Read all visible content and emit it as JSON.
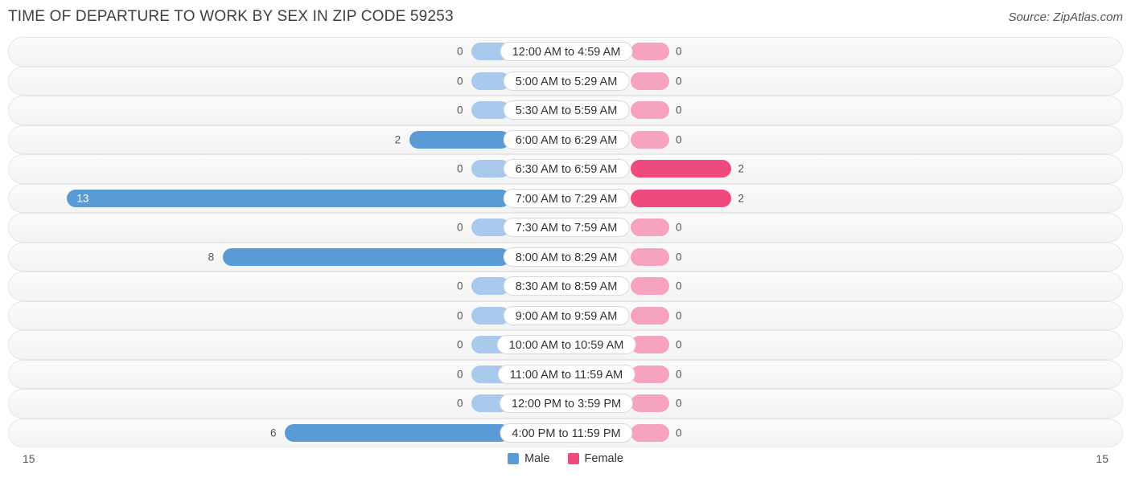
{
  "header": {
    "title": "TIME OF DEPARTURE TO WORK BY SEX IN ZIP CODE 59253",
    "source": "Source: ZipAtlas.com"
  },
  "legend": {
    "male_label": "Male",
    "female_label": "Female",
    "male_color": "#5b9bd5",
    "female_color": "#ef4a7e"
  },
  "axis": {
    "left_max": "15",
    "right_max": "15"
  },
  "chart_data": {
    "type": "bar",
    "orientation": "horizontal-diverging",
    "title": "TIME OF DEPARTURE TO WORK BY SEX IN ZIP CODE 59253",
    "xlabel": "",
    "ylabel": "",
    "xlim": [
      15,
      15
    ],
    "grid": false,
    "legend_position": "bottom-center",
    "categories": [
      "12:00 AM to 4:59 AM",
      "5:00 AM to 5:29 AM",
      "5:30 AM to 5:59 AM",
      "6:00 AM to 6:29 AM",
      "6:30 AM to 6:59 AM",
      "7:00 AM to 7:29 AM",
      "7:30 AM to 7:59 AM",
      "8:00 AM to 8:29 AM",
      "8:30 AM to 8:59 AM",
      "9:00 AM to 9:59 AM",
      "10:00 AM to 10:59 AM",
      "11:00 AM to 11:59 AM",
      "12:00 PM to 3:59 PM",
      "4:00 PM to 11:59 PM"
    ],
    "series": [
      {
        "name": "Male",
        "color": "#5b9bd5",
        "values": [
          0,
          0,
          0,
          2,
          0,
          13,
          0,
          8,
          0,
          0,
          0,
          0,
          0,
          6
        ]
      },
      {
        "name": "Female",
        "color": "#ef4a7e",
        "values": [
          0,
          0,
          0,
          0,
          2,
          2,
          0,
          0,
          0,
          0,
          0,
          0,
          0,
          0
        ]
      }
    ]
  }
}
